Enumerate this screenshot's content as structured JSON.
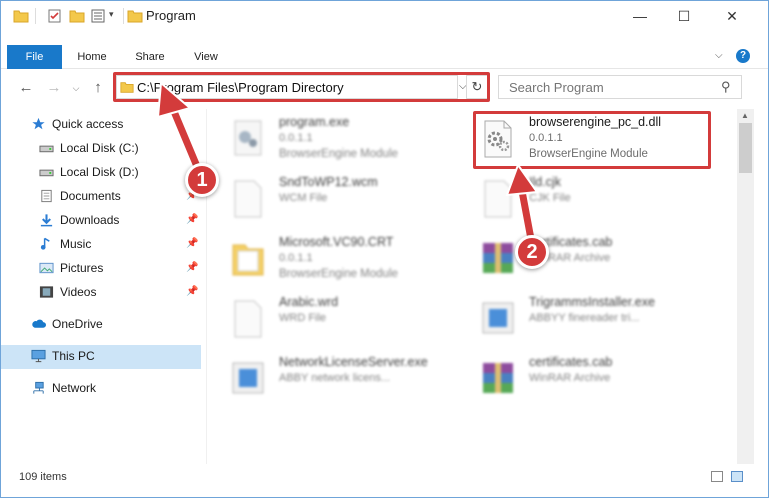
{
  "window": {
    "title": "Program",
    "ribbon_tabs": [
      "File",
      "Home",
      "Share",
      "View"
    ]
  },
  "address": {
    "path": "C:\\Program Files\\Program Directory",
    "search_placeholder": "Search Program"
  },
  "nav": {
    "items": [
      {
        "label": "Quick access",
        "icon": "star-icon"
      },
      {
        "label": "Local Disk (C:)",
        "icon": "drive-icon"
      },
      {
        "label": "Local Disk (D:)",
        "icon": "drive-icon"
      },
      {
        "label": "Documents",
        "icon": "documents-icon",
        "pinned": true
      },
      {
        "label": "Downloads",
        "icon": "download-icon",
        "pinned": true
      },
      {
        "label": "Music",
        "icon": "music-icon",
        "pinned": true
      },
      {
        "label": "Pictures",
        "icon": "pictures-icon",
        "pinned": true
      },
      {
        "label": "Videos",
        "icon": "videos-icon",
        "pinned": true
      },
      {
        "label": "OneDrive",
        "icon": "cloud-icon"
      },
      {
        "label": "This PC",
        "icon": "computer-icon",
        "selected": true
      },
      {
        "label": "Network",
        "icon": "network-icon"
      }
    ]
  },
  "files": [
    {
      "name": "program.exe",
      "line2": "0.0.1.1",
      "line3": "BrowserEngine Module",
      "icon": "exe-icon"
    },
    {
      "name": "browserengine_pc_d.dll",
      "line2": "0.0.1.1",
      "line3": "BrowserEngine Module",
      "icon": "dll-gear-icon"
    },
    {
      "name": "SndToWP12.wcm",
      "line2": "WCM File",
      "line3": "",
      "icon": "blank-file-icon"
    },
    {
      "name": "Ild.cjk",
      "line2": "CJK File",
      "line3": "",
      "icon": "blank-file-icon"
    },
    {
      "name": "Microsoft.VC90.CRT",
      "line2": "0.0.1.1",
      "line3": "BrowserEngine Module",
      "icon": "folder-icon"
    },
    {
      "name": "certificates.cab",
      "line2": "WinRAR Archive",
      "line3": "",
      "icon": "winrar-icon"
    },
    {
      "name": "Arabic.wrd",
      "line2": "WRD File",
      "line3": "",
      "icon": "blank-file-icon"
    },
    {
      "name": "TrigrammsInstaller.exe",
      "line2": "ABBYY finereader tri...",
      "line3": "",
      "icon": "installer-icon"
    },
    {
      "name": "NetworkLicenseServer.exe",
      "line2": "ABBY network licens...",
      "line3": "",
      "icon": "installer-icon"
    },
    {
      "name": "certificates.cab",
      "line2": "WinRAR Archive",
      "line3": "",
      "icon": "winrar-icon"
    }
  ],
  "status": {
    "count": "109 items"
  },
  "annotations": {
    "step1": "1",
    "step2": "2"
  },
  "colors": {
    "accent": "#1979ca",
    "highlight": "#d33b3b",
    "selected": "#cce4f7"
  }
}
